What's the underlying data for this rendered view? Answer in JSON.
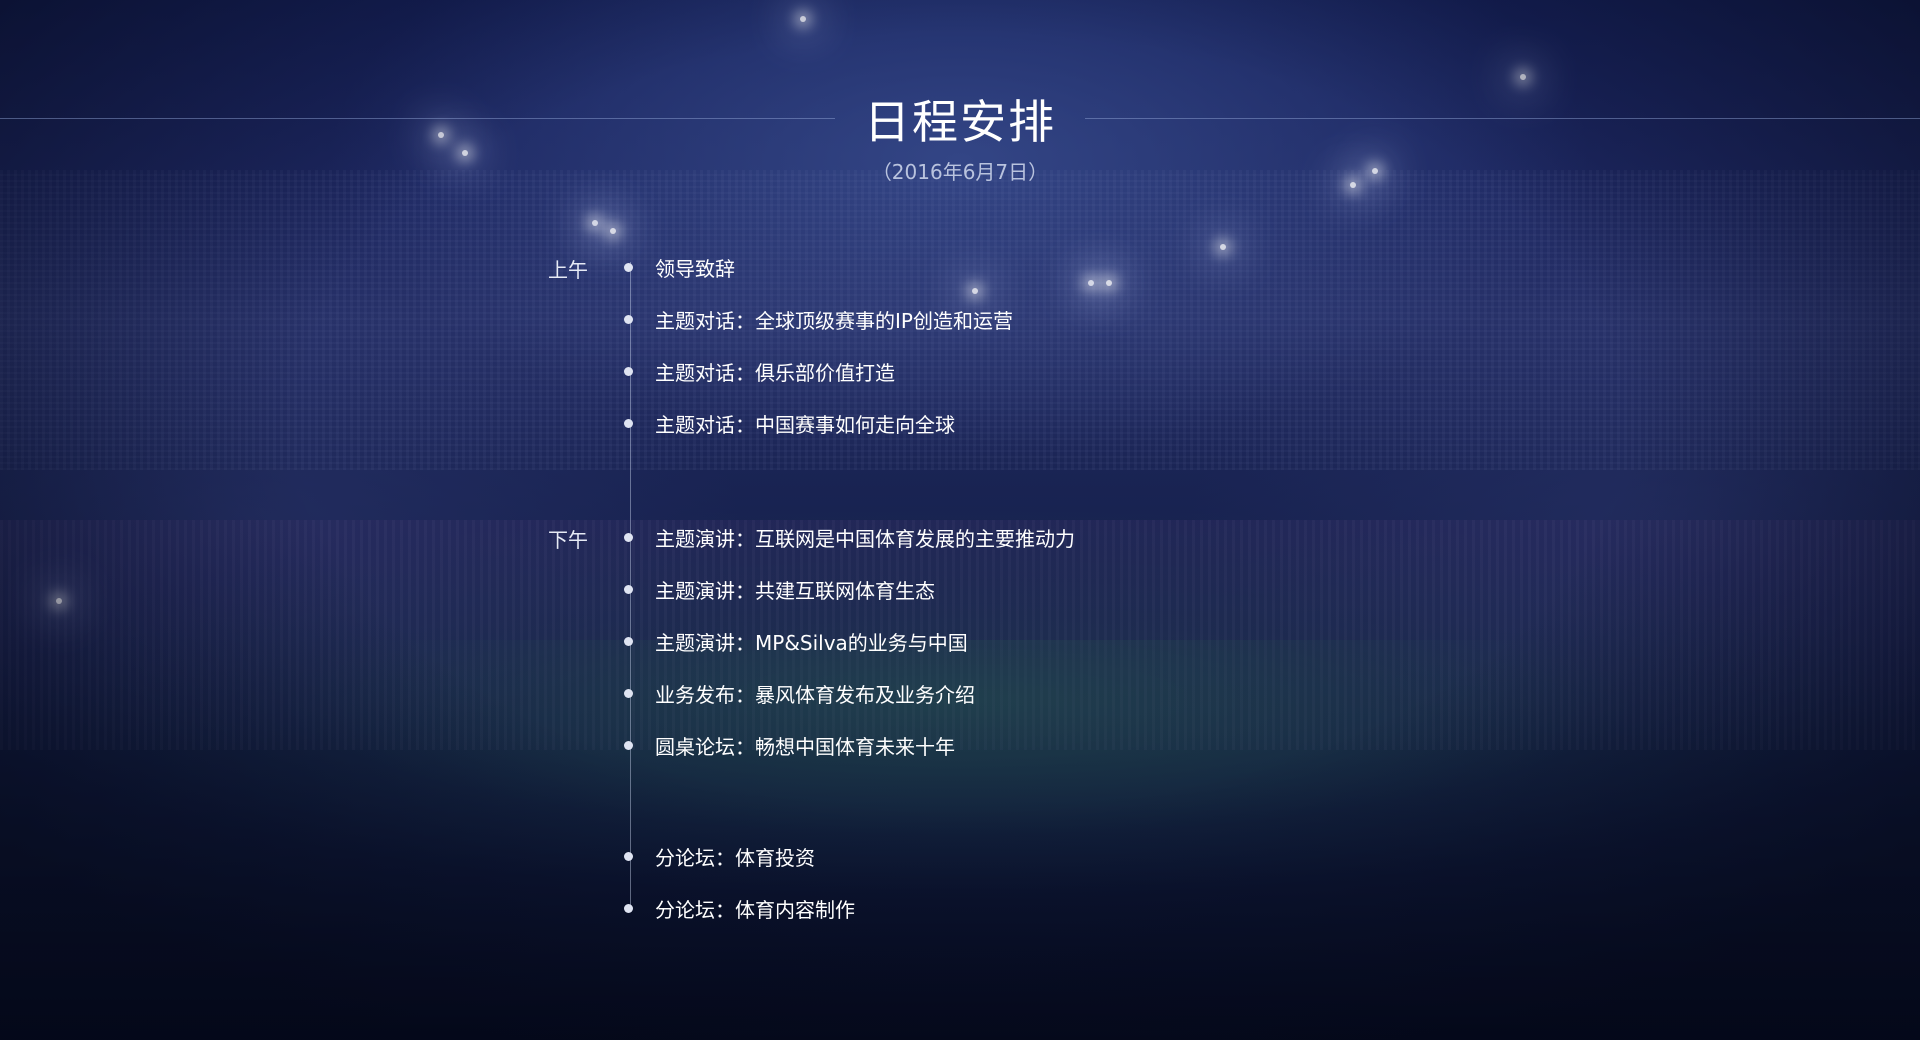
{
  "title": "日程安排",
  "date": "（2016年6月7日）",
  "sessions": [
    {
      "period": "上午",
      "items": [
        "领导致辞",
        "主题对话：全球顶级赛事的IP创造和运营",
        "主题对话：俱乐部价值打造",
        "主题对话：中国赛事如何走向全球"
      ]
    },
    {
      "period": "下午",
      "items": [
        "主题演讲：互联网是中国体育发展的主要推动力",
        "主题演讲：共建互联网体育生态",
        "主题演讲：MP&Silva的业务与中国",
        "业务发布：暴风体育发布及业务介绍",
        "圆桌论坛：畅想中国体育未来十年"
      ]
    },
    {
      "period": "",
      "items": [
        "分论坛：体育投资",
        "分论坛：体育内容制作"
      ]
    }
  ]
}
